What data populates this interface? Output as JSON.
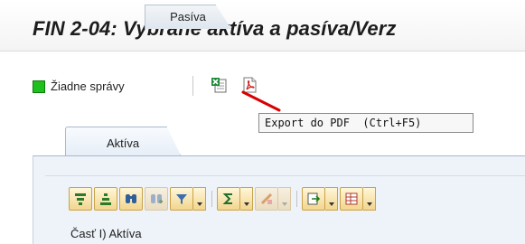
{
  "title": "FIN 2-04: Vybrané aktíva a pasíva/Verz",
  "status": {
    "message": "Žiadne správy",
    "indicator_color": "#1ec01e"
  },
  "toolbar": {
    "buttons": [
      {
        "icon": "export-excel-icon"
      },
      {
        "icon": "export-pdf-icon"
      }
    ]
  },
  "tooltip": {
    "text": "Export do PDF  (Ctrl+F5)"
  },
  "tabs": [
    {
      "label": "Aktíva",
      "active": true
    },
    {
      "label": "Pasíva",
      "active": false
    }
  ],
  "alv_toolbar": {
    "buttons": [
      {
        "icon": "sort-ascending-icon",
        "enabled": true
      },
      {
        "icon": "sort-descending-icon",
        "enabled": true
      },
      {
        "icon": "find-icon",
        "enabled": true
      },
      {
        "icon": "find-next-icon",
        "enabled": false
      },
      {
        "icon": "filter-icon",
        "enabled": true,
        "dropdown": true
      },
      {
        "icon": "sum-icon",
        "enabled": true,
        "dropdown": true
      },
      {
        "icon": "subtotal-icon",
        "enabled": false,
        "dropdown": true
      },
      {
        "icon": "export-icon",
        "enabled": true,
        "dropdown": true
      },
      {
        "icon": "layout-icon",
        "enabled": true,
        "dropdown": true
      }
    ]
  },
  "table": {
    "section_label": "Časť I) Aktíva"
  },
  "colors": {
    "tab_border": "#a7b9cc",
    "panel_bg": "#eef3f9",
    "button_gold": "#f2d58e"
  }
}
